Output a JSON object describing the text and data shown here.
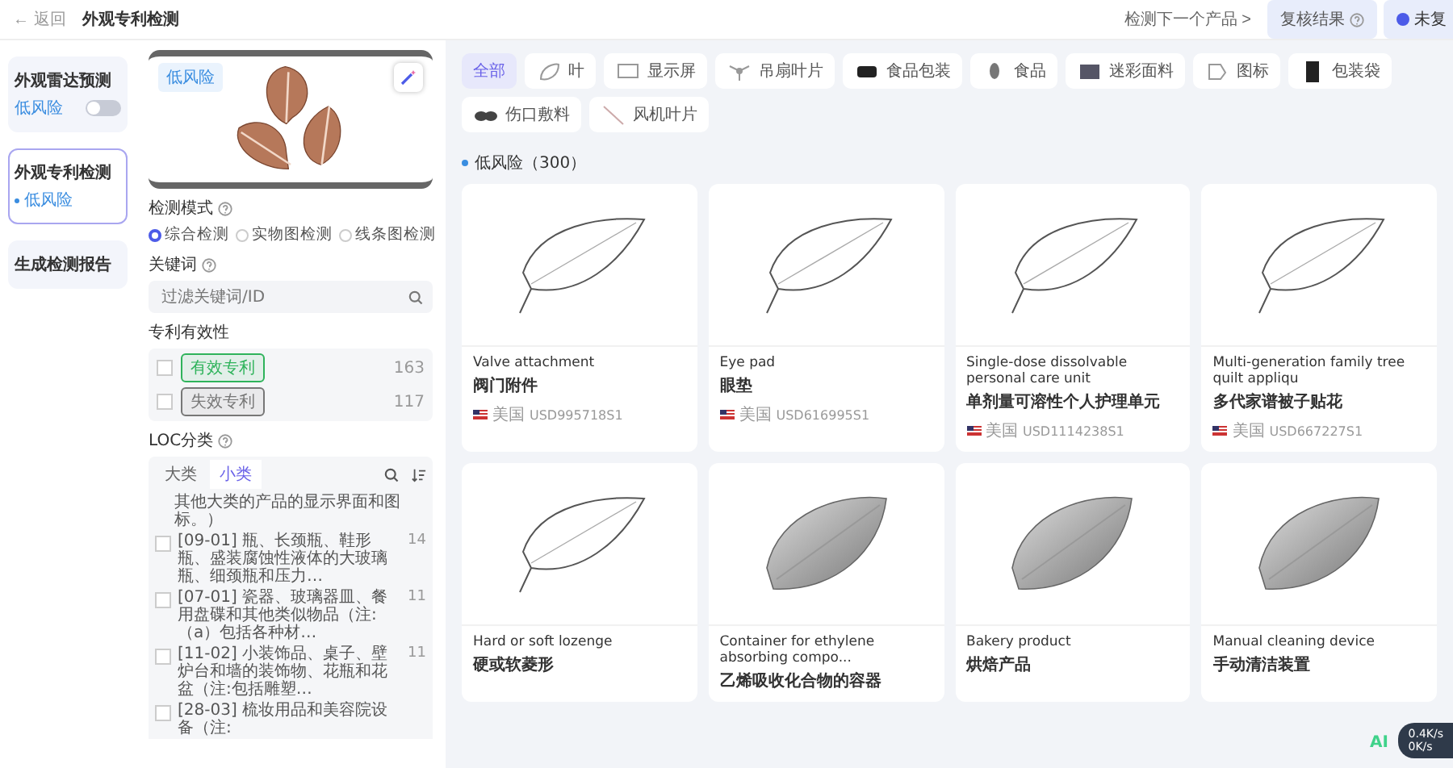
{
  "header": {
    "back": "← 返回",
    "title": "外观专利检测",
    "next": "检测下一个产品 >",
    "review": "复核结果",
    "status": "未复"
  },
  "steps": [
    {
      "title": "外观雷达预测",
      "sub": "低风险",
      "selected": false,
      "kind": "toggle"
    },
    {
      "title": "外观专利检测",
      "sub": "低风险",
      "selected": true,
      "kind": "dot"
    },
    {
      "title": "生成检测报告",
      "selected": false
    }
  ],
  "filter": {
    "image_tag": "低风险",
    "mode_label": "检测模式",
    "modes": [
      {
        "label": "综合检测",
        "selected": true
      },
      {
        "label": "实物图检测",
        "selected": false
      },
      {
        "label": "线条图检测",
        "selected": false
      }
    ],
    "keyword_label": "关键词",
    "keyword_placeholder": "过滤关键词/ID",
    "validity_label": "专利有效性",
    "validity": [
      {
        "label": "有效专利",
        "count": "163",
        "checked": false,
        "color": "#2fb35b"
      },
      {
        "label": "失效专利",
        "count": "117",
        "checked": false,
        "color": "#777777"
      }
    ],
    "loc_label": "LOC分类",
    "loc_tabs": [
      {
        "label": "大类",
        "selected": false
      },
      {
        "label": "小类",
        "selected": true
      }
    ],
    "loc_items": [
      {
        "text": "其他大类的产品的显示界面和图标。）",
        "kind": "tail"
      },
      {
        "text": "[09-01] 瓶、长颈瓶、鞋形瓶、盛装腐蚀性液体的大玻璃瓶、细颈瓶和压力…",
        "count": "14",
        "checked": false,
        "kind": "item"
      },
      {
        "text": "[07-01] 瓷器、玻璃器皿、餐用盘碟和其他类似物品（注:（a）包括各种材…",
        "count": "11",
        "checked": false,
        "kind": "item"
      },
      {
        "text": "[11-02] 小装饰品、桌子、壁炉台和墙的装饰物、花瓶和花盆（注:包括雕塑…",
        "count": "11",
        "checked": false,
        "kind": "item"
      },
      {
        "text": "[28-03] 梳妆用品和美容院设备（注:",
        "checked": false,
        "kind": "item"
      }
    ]
  },
  "categories": [
    {
      "label": "全部",
      "selected": true,
      "kind": "text"
    },
    {
      "label": "叶",
      "selected": false,
      "kind": "thumb"
    },
    {
      "label": "显示屏",
      "selected": false,
      "kind": "thumb"
    },
    {
      "label": "吊扇叶片",
      "selected": false,
      "kind": "thumb"
    },
    {
      "label": "食品包装",
      "selected": false,
      "kind": "thumb"
    },
    {
      "label": "食品",
      "selected": false,
      "kind": "thumb"
    },
    {
      "label": "迷彩面料",
      "selected": false,
      "kind": "thumb"
    },
    {
      "label": "图标",
      "selected": false,
      "kind": "thumb"
    },
    {
      "label": "包装袋",
      "selected": false,
      "kind": "thumb"
    },
    {
      "label": "伤口敷料",
      "selected": false,
      "kind": "thumb"
    },
    {
      "label": "风机叶片",
      "selected": false,
      "kind": "thumb"
    }
  ],
  "section": "低风险（300）",
  "results": [
    {
      "title": "Valve attachment",
      "title_cn": "阀门附件",
      "country": "美国",
      "id": "USD995718S1",
      "kind": "line"
    },
    {
      "title": "Eye pad",
      "title_cn": "眼垫",
      "country": "美国",
      "id": "USD616995S1",
      "kind": "line"
    },
    {
      "title": "Single-dose dissolvable personal care unit",
      "title_cn": "单剂量可溶性个人护理单元",
      "country": "美国",
      "id": "USD1114238S1",
      "kind": "line"
    },
    {
      "title": "Multi-generation family tree quilt appliqu",
      "title_cn": "多代家谱被子贴花",
      "country": "美国",
      "id": "USD667227S1",
      "kind": "line"
    },
    {
      "title": "Hard or soft lozenge",
      "title_cn": "硬或软菱形",
      "kind": "line"
    },
    {
      "title": "Container for ethylene absorbing compo...",
      "title_cn": "乙烯吸收化合物的容器",
      "kind": "render"
    },
    {
      "title": "Bakery product",
      "title_cn": "烘焙产品",
      "kind": "render"
    },
    {
      "title": "Manual cleaning device",
      "title_cn": "手动清洁装置",
      "kind": "render"
    }
  ],
  "widget": {
    "label": "AI",
    "up": "0.4K/s",
    "down": "0K/s"
  }
}
